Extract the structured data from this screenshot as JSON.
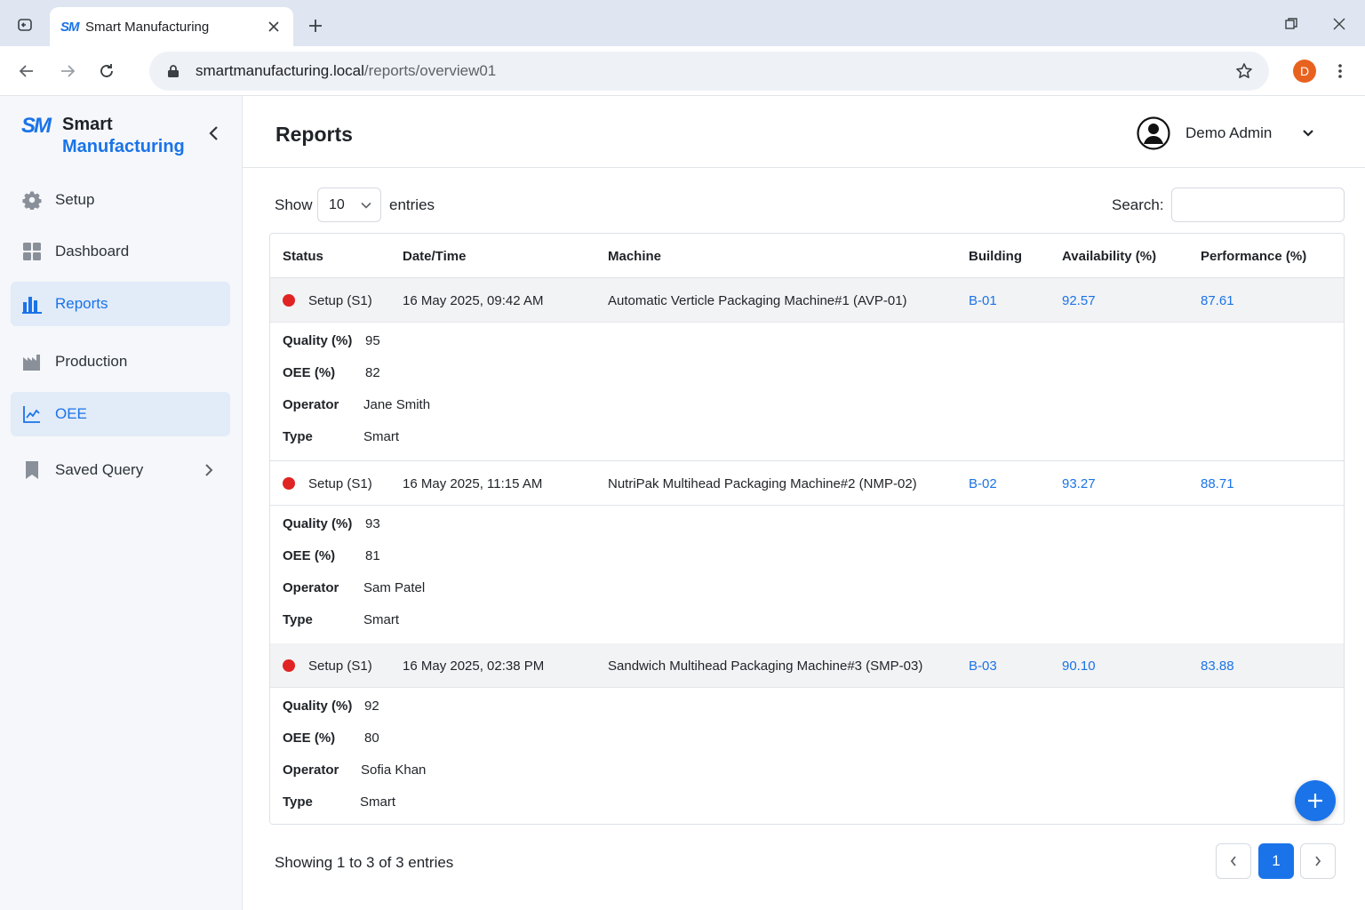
{
  "browser": {
    "tab_title": "Smart Manufacturing",
    "tab_logo": "SM",
    "url_host": "smartmanufacturing.local",
    "url_path": "/reports/overview01",
    "profile_initial": "D"
  },
  "sidebar": {
    "logo": "SM",
    "brand_line1": "Smart",
    "brand_line2": "Manufacturing",
    "items": [
      {
        "label": "Setup",
        "icon": "gear-icon"
      },
      {
        "label": "Dashboard",
        "icon": "grid-icon"
      },
      {
        "label": "Reports",
        "icon": "bar-chart-icon",
        "active": true
      },
      {
        "label": "Production",
        "icon": "factory-icon"
      },
      {
        "label": "OEE",
        "icon": "line-chart-icon",
        "active": true
      },
      {
        "label": "Saved Query",
        "icon": "bookmark-icon"
      }
    ]
  },
  "header": {
    "title": "Reports",
    "user_name": "Demo Admin"
  },
  "controls": {
    "show_label": "Show",
    "entries_value": "10",
    "entries_label": "entries",
    "search_label": "Search:",
    "search_value": ""
  },
  "table": {
    "columns": [
      "Status",
      "Date/Time",
      "Machine",
      "Building",
      "Availability (%)",
      "Performance (%)"
    ],
    "detail_labels": {
      "quality": "Quality (%)",
      "oee": "OEE (%)",
      "operator": "Operator",
      "type": "Type"
    },
    "rows": [
      {
        "status": "Setup (S1)",
        "datetime": "16 May 2025, 09:42 AM",
        "machine": "Automatic Verticle Packaging Machine#1 (AVP-01)",
        "building": "B-01",
        "availability": "92.57",
        "performance": "87.61",
        "quality": "95",
        "oee": "82",
        "operator": "Jane Smith",
        "type": "Smart"
      },
      {
        "status": "Setup (S1)",
        "datetime": "16 May 2025, 11:15 AM",
        "machine": "NutriPak Multihead Packaging Machine#2 (NMP-02)",
        "building": "B-02",
        "availability": "93.27",
        "performance": "88.71",
        "quality": "93",
        "oee": "81",
        "operator": "Sam Patel",
        "type": "Smart"
      },
      {
        "status": "Setup (S1)",
        "datetime": "16 May 2025, 02:38 PM",
        "machine": "Sandwich Multihead Packaging Machine#3 (SMP-03)",
        "building": "B-03",
        "availability": "90.10",
        "performance": "83.88",
        "quality": "92",
        "oee": "80",
        "operator": "Sofia Khan",
        "type": "Smart"
      }
    ]
  },
  "footer": {
    "info": "Showing 1 to 3 of 3 entries",
    "current_page": "1"
  },
  "colors": {
    "accent": "#1a73e8",
    "status_red": "#e02424",
    "sidebar_active_bg": "#e2ebf8"
  }
}
